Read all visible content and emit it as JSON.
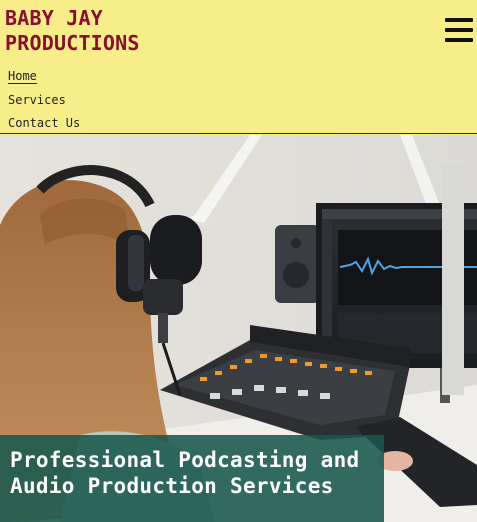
{
  "site": {
    "brand_line1": "BABY JAY",
    "brand_line2": "PRODUCTIONS"
  },
  "nav": {
    "menu_icon": "hamburger-menu-icon",
    "items": [
      {
        "label": "Home",
        "active": true
      },
      {
        "label": "Services",
        "active": false
      },
      {
        "label": "Contact Us",
        "active": false
      }
    ]
  },
  "hero": {
    "headline": "Professional Podcasting and Audio Production Services"
  },
  "colors": {
    "header_bg": "#f7ee8a",
    "brand_text": "#8a0f2e",
    "caption_bg": "#18584e"
  }
}
